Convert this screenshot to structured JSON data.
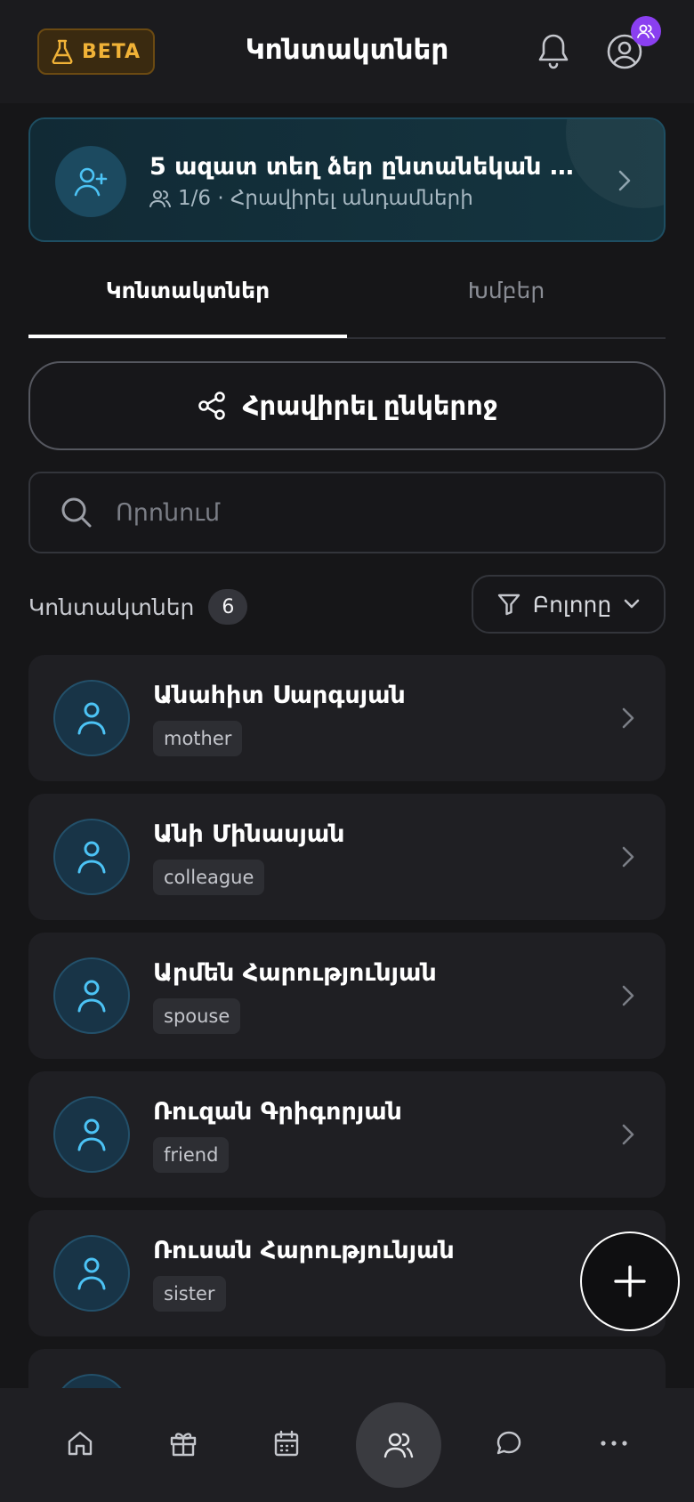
{
  "header": {
    "beta_label": "BETA",
    "title": "Կոնտակտներ",
    "icons": [
      "flask-icon",
      "bell-icon",
      "user-circle-icon",
      "users-badge-icon"
    ]
  },
  "banner": {
    "title": "5 ազատ տեղ ձեր ընտանեկան խ...",
    "subtitle": "1/6 · Հրավիրել անդամների",
    "icon": "user-plus-icon"
  },
  "tabs": [
    {
      "label": "Կոնտակտներ",
      "active": true
    },
    {
      "label": "Խմբեր",
      "active": false
    }
  ],
  "invite_button": {
    "label": "Հրավիրել ընկերոջ",
    "icon": "share-icon"
  },
  "search": {
    "placeholder": "Որոնում",
    "value": ""
  },
  "contacts_header": {
    "label": "Կոնտակտներ",
    "count": "6"
  },
  "filter": {
    "label": "Բոլորը",
    "icon": "filter-icon"
  },
  "contacts": [
    {
      "name": "Անահիտ Սարգսյան",
      "tag": "mother"
    },
    {
      "name": "Անի Մինասյան",
      "tag": "colleague"
    },
    {
      "name": "Արմեն Հարությունյան",
      "tag": "spouse"
    },
    {
      "name": "Ռուզան Գրիգորյան",
      "tag": "friend"
    },
    {
      "name": "Ռուսան Հարությունյան",
      "tag": "sister"
    }
  ],
  "fab": {
    "icon": "plus-icon"
  },
  "bottom_nav": [
    {
      "icon": "home-icon",
      "active": false
    },
    {
      "icon": "gift-icon",
      "active": false
    },
    {
      "icon": "calendar-icon",
      "active": false
    },
    {
      "icon": "users-icon",
      "active": true
    },
    {
      "icon": "chat-icon",
      "active": false
    },
    {
      "icon": "more-icon",
      "active": false
    }
  ],
  "colors": {
    "background": "#161618",
    "accent_beta": "#f0b237",
    "accent_blue": "#4cc3f5",
    "badge_purple": "#8a3ff0"
  }
}
